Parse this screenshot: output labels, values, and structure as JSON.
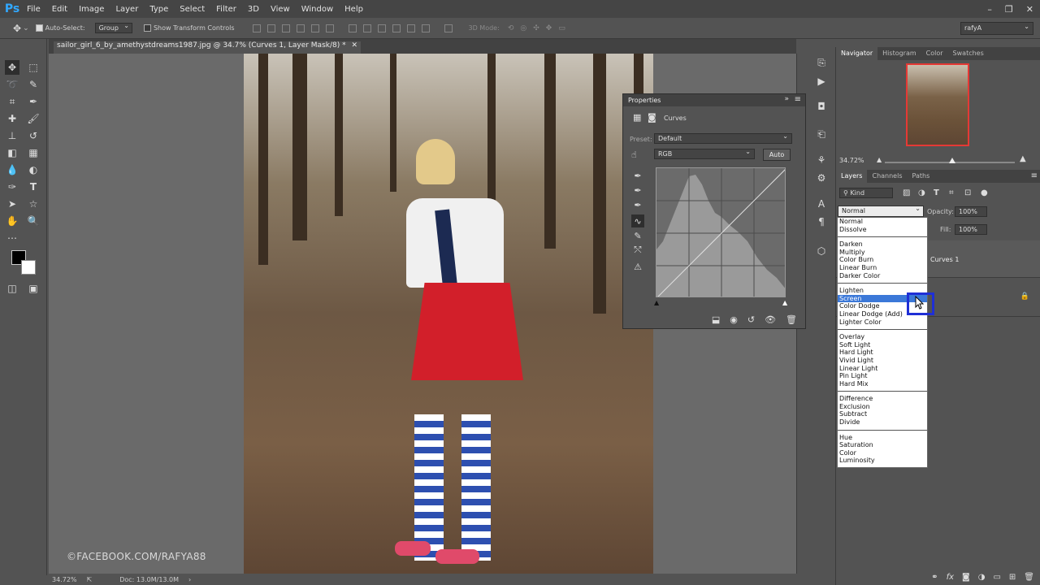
{
  "menubar": {
    "logo": "Ps",
    "items": [
      "File",
      "Edit",
      "Image",
      "Layer",
      "Type",
      "Select",
      "Filter",
      "3D",
      "View",
      "Window",
      "Help"
    ]
  },
  "options": {
    "auto_select_label": "Auto-Select:",
    "auto_select_value": "Group",
    "transform_label": "Show Transform Controls",
    "mode_3d": "3D Mode:",
    "workspace": "rafyA"
  },
  "document": {
    "tab_title": "sailor_girl_6_by_amethystdreams1987.jpg @ 34.7% (Curves 1, Layer Mask/8) *",
    "watermark": "©FACEBOOK.COM/RAFYA88",
    "status_zoom": "34.72%",
    "status_doc": "Doc: 13.0M/13.0M"
  },
  "properties": {
    "title": "Properties",
    "panel_name": "Curves",
    "preset_label": "Preset:",
    "preset_value": "Default",
    "channel_value": "RGB",
    "auto_label": "Auto"
  },
  "navigator": {
    "tabs": [
      "Navigator",
      "Histogram",
      "Color",
      "Swatches"
    ],
    "zoom": "34.72%",
    "zoom_fraction": 0.52
  },
  "layers": {
    "tabs": [
      "Layers",
      "Channels",
      "Paths"
    ],
    "filter_kind": "Kind",
    "blend_mode": "Normal",
    "opacity_label": "Opacity:",
    "opacity_value": "100%",
    "fill_label": "Fill:",
    "fill_value": "100%",
    "curves_layer_name": "Curves 1"
  },
  "blend_list": {
    "groups": [
      [
        "Normal",
        "Dissolve"
      ],
      [
        "Darken",
        "Multiply",
        "Color Burn",
        "Linear Burn",
        "Darker Color"
      ],
      [
        "Lighten",
        "Screen",
        "Color Dodge",
        "Linear Dodge (Add)",
        "Lighter Color"
      ],
      [
        "Overlay",
        "Soft Light",
        "Hard Light",
        "Vivid Light",
        "Linear Light",
        "Pin Light",
        "Hard Mix"
      ],
      [
        "Difference",
        "Exclusion",
        "Subtract",
        "Divide"
      ],
      [
        "Hue",
        "Saturation",
        "Color",
        "Luminosity"
      ]
    ],
    "highlighted": "Screen"
  },
  "colors": {
    "highlight": "#3b78d8",
    "annotation_box": "#1f2fd6",
    "ps_blue": "#31a8ff"
  }
}
